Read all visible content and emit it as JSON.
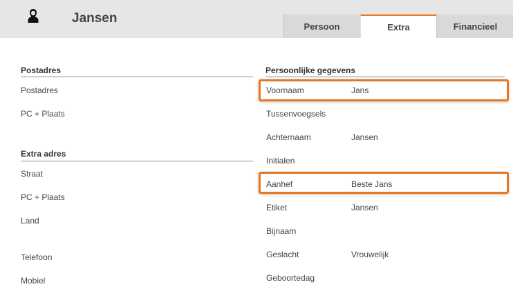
{
  "header": {
    "title": "Jansen",
    "avatar_icon": "person-silhouette-icon",
    "tabs": [
      {
        "label": "Persoon",
        "active": false
      },
      {
        "label": "Extra",
        "active": true
      },
      {
        "label": "Financieel",
        "active": false
      }
    ],
    "accent_color": "#e87722"
  },
  "left": {
    "postadres": {
      "title": "Postadres",
      "fields": [
        {
          "label": "Postadres",
          "value": ""
        },
        {
          "label": "PC + Plaats",
          "value": ""
        }
      ]
    },
    "extra_adres": {
      "title": "Extra adres",
      "fields": [
        {
          "label": "Straat",
          "value": ""
        },
        {
          "label": "PC + Plaats",
          "value": ""
        },
        {
          "label": "Land",
          "value": ""
        }
      ]
    },
    "contact": [
      {
        "label": "Telefoon",
        "value": ""
      },
      {
        "label": "Mobiel",
        "value": ""
      }
    ]
  },
  "right": {
    "title": "Persoonlijke gegevens",
    "fields": [
      {
        "label": "Voornaam",
        "value": "Jans",
        "highlighted": true
      },
      {
        "label": "Tussenvoegsels",
        "value": ""
      },
      {
        "label": "Achternaam",
        "value": "Jansen"
      },
      {
        "label": "Initialen",
        "value": ""
      },
      {
        "label": "Aanhef",
        "value": "Beste Jans",
        "highlighted": true
      },
      {
        "label": "Etiket",
        "value": "Jansen"
      },
      {
        "label": "Bijnaam",
        "value": ""
      },
      {
        "label": "Geslacht",
        "value": "Vrouwelijk"
      },
      {
        "label": "Geboortedag",
        "value": ""
      }
    ]
  }
}
